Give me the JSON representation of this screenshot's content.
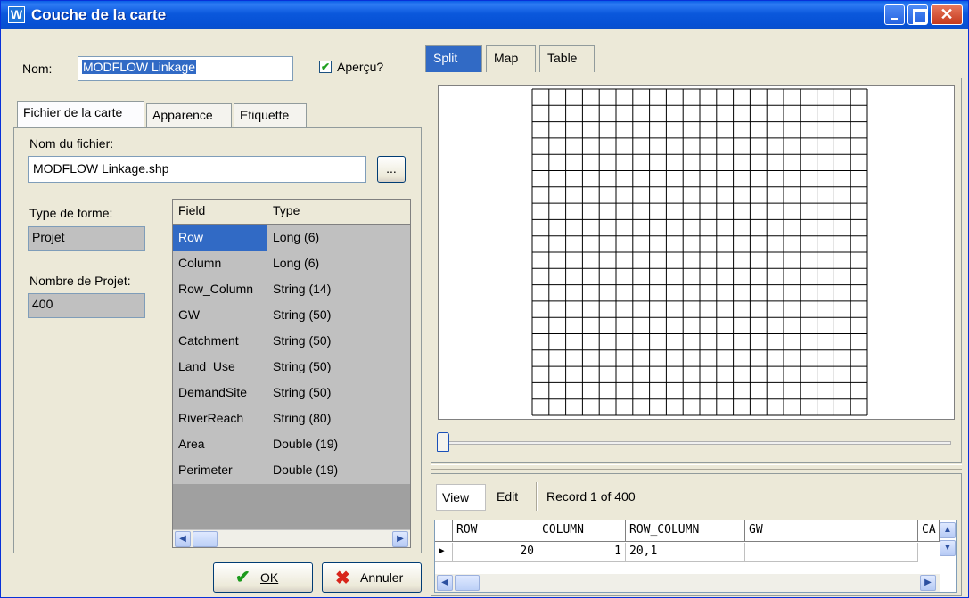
{
  "window": {
    "title": "Couche de la carte",
    "app_icon": "W",
    "accent": "#0b58dc"
  },
  "left": {
    "name_label": "Nom:",
    "name_value": "MODFLOW Linkage",
    "preview_label": "Aperçu?",
    "preview_checked": true,
    "tabs": [
      "Fichier de la carte",
      "Apparence",
      "Etiquette"
    ],
    "active_tab": "Fichier de la carte",
    "file_label": "Nom du fichier:",
    "file_value": "MODFLOW Linkage.shp",
    "browse_label": "...",
    "shape_type_label": "Type de forme:",
    "shape_type_value": "Projet",
    "count_label": "Nombre de Projet:",
    "count_value": "400",
    "fields_table": {
      "headers": [
        "Field",
        "Type"
      ],
      "rows": [
        [
          "Row",
          "Long (6)"
        ],
        [
          "Column",
          "Long (6)"
        ],
        [
          "Row_Column",
          "String (14)"
        ],
        [
          "GW",
          "String (50)"
        ],
        [
          "Catchment",
          "String (50)"
        ],
        [
          "Land_Use",
          "String (50)"
        ],
        [
          "DemandSite",
          "String (50)"
        ],
        [
          "RiverReach",
          "String (80)"
        ],
        [
          "Area",
          "Double (19)"
        ],
        [
          "Perimeter",
          "Double (19)"
        ]
      ],
      "selected_row": 0
    },
    "ok_label": "OK",
    "cancel_label": "Annuler"
  },
  "right": {
    "tabs": [
      "Split",
      "Map",
      "Table"
    ],
    "active_tab": "Split",
    "grid_cells": 20,
    "view_label": "View",
    "edit_label": "Edit",
    "record_text": "Record 1 of 400",
    "table": {
      "headers": [
        "ROW",
        "COLUMN",
        "ROW_COLUMN",
        "GW",
        "CA"
      ],
      "row": [
        "20",
        "1",
        "20,1",
        "",
        ""
      ]
    }
  }
}
